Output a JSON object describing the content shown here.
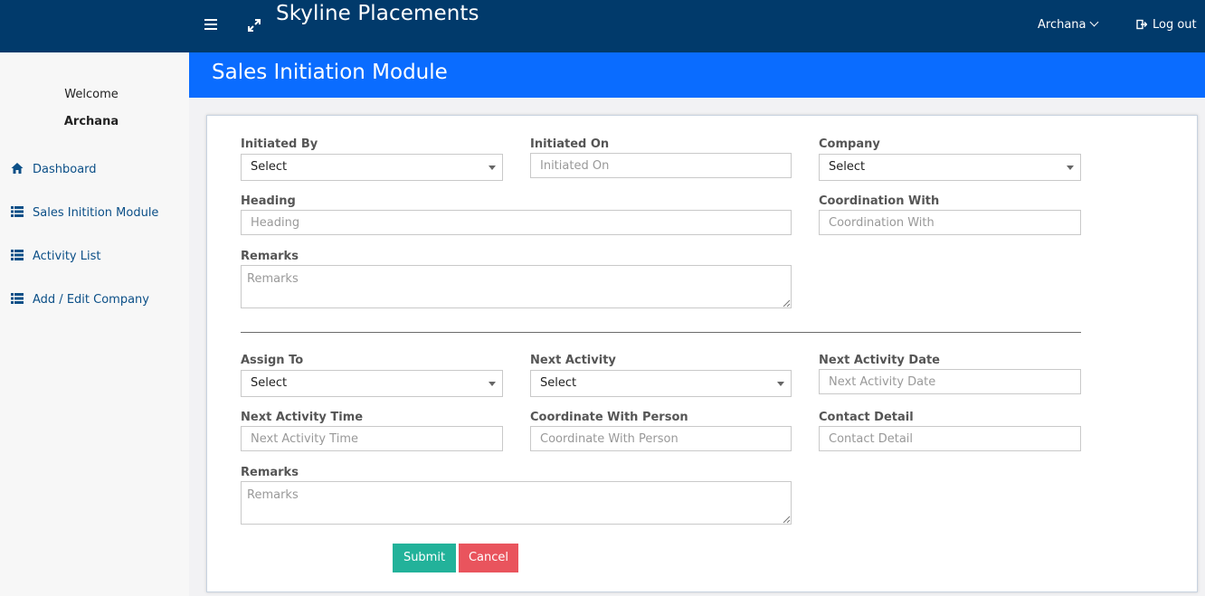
{
  "header": {
    "app_title": "Skyline Placements",
    "user_name": "Archana",
    "logout_label": "Log out",
    "bg_color": "#013a6b"
  },
  "sidebar": {
    "welcome_text": "Welcome",
    "user_name": "Archana",
    "items": [
      {
        "label": "Dashboard",
        "icon": "home-icon"
      },
      {
        "label": "Sales Initition Module",
        "icon": "list-icon"
      },
      {
        "label": "Activity List",
        "icon": "list-icon"
      },
      {
        "label": "Add / Edit Company",
        "icon": "list-icon"
      }
    ]
  },
  "module": {
    "title": "Sales Initiation Module",
    "band_color": "#0a6cff"
  },
  "form": {
    "initiated_by": {
      "label": "Initiated By",
      "value": "Select"
    },
    "initiated_on": {
      "label": "Initiated On",
      "placeholder": "Initiated On"
    },
    "company": {
      "label": "Company",
      "value": "Select"
    },
    "heading": {
      "label": "Heading",
      "placeholder": "Heading"
    },
    "coordination_with": {
      "label": "Coordination With",
      "placeholder": "Coordination With"
    },
    "remarks_1": {
      "label": "Remarks",
      "placeholder": "Remarks"
    },
    "assign_to": {
      "label": "Assign To",
      "value": "Select"
    },
    "next_activity": {
      "label": "Next Activity",
      "value": "Select"
    },
    "next_activity_date": {
      "label": "Next Activity Date",
      "placeholder": "Next Activity Date"
    },
    "next_activity_time": {
      "label": "Next Activity Time",
      "placeholder": "Next Activity Time"
    },
    "coordinate_with_person": {
      "label": "Coordinate With Person",
      "placeholder": "Coordinate With Person"
    },
    "contact_detail": {
      "label": "Contact Detail",
      "placeholder": "Contact Detail"
    },
    "remarks_2": {
      "label": "Remarks",
      "placeholder": "Remarks"
    },
    "submit_label": "Submit",
    "cancel_label": "Cancel",
    "submit_color": "#22b29a",
    "cancel_color": "#e9545d"
  }
}
